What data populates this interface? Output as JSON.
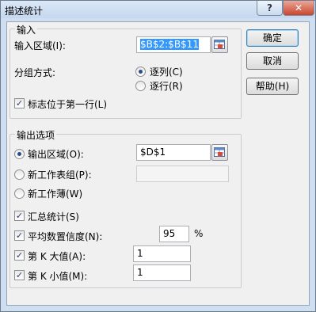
{
  "window": {
    "title": "描述统计",
    "help_glyph": "?",
    "close_glyph": "✕"
  },
  "input_group": {
    "title": "输入",
    "range_label": "输入区域(I):",
    "range_value": "$B$2:$B$11",
    "grouping_label": "分组方式:",
    "by_columns": "逐列(C)",
    "by_rows": "逐行(R)",
    "labels_first_row": "标志位于第一行(L)"
  },
  "buttons": {
    "ok": "确定",
    "cancel": "取消",
    "help": "帮助(H)"
  },
  "output_group": {
    "title": "输出选项",
    "output_range": "输出区域(O):",
    "output_range_value": "$D$1",
    "new_sheet": "新工作表组(P):",
    "new_sheet_value": "",
    "new_workbook": "新工作薄(W)",
    "summary_stats": "汇总统计(S)",
    "confidence": "平均数置信度(N):",
    "confidence_value": "95",
    "percent": "%",
    "kth_largest": "第 K 大值(A):",
    "kth_largest_value": "1",
    "kth_smallest": "第 K 小值(M):",
    "kth_smallest_value": "1"
  },
  "state": {
    "grouping": "columns",
    "labels_first_row": true,
    "output": "output_range",
    "summary_stats": true,
    "confidence": true,
    "kth_largest": true,
    "kth_smallest": true
  },
  "icons": {
    "ref_button": "range-select-icon",
    "check": "✓"
  }
}
